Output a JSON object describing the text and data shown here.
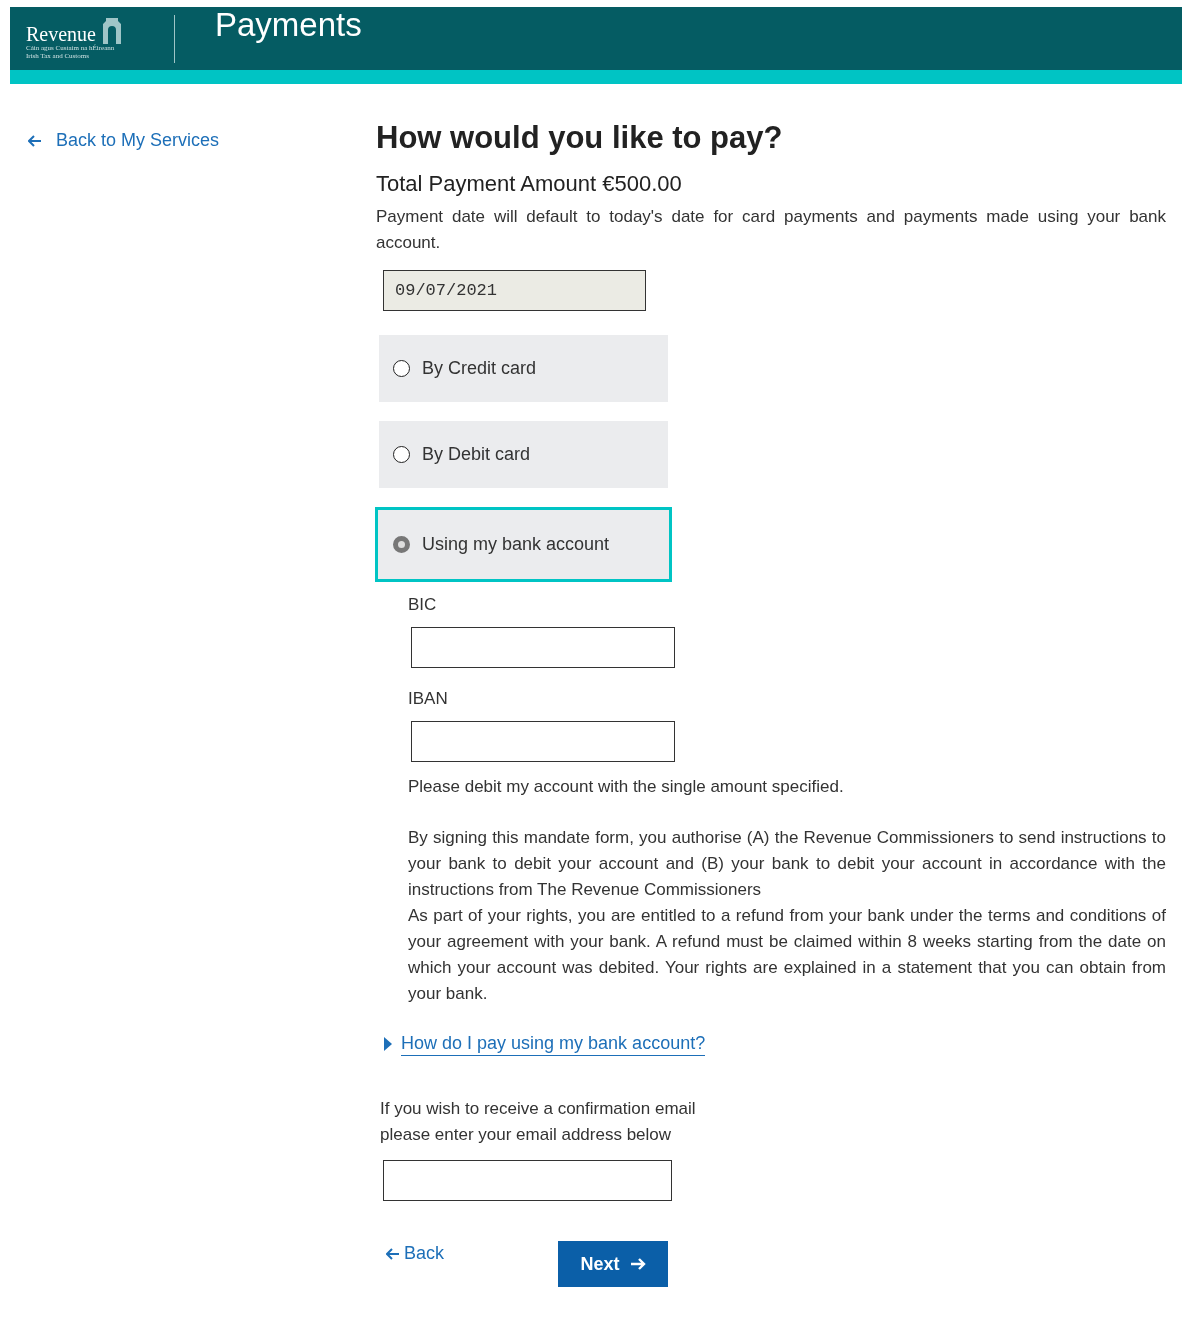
{
  "header": {
    "logo": {
      "name": "Revenue",
      "line_1": "Cáin agus Custaim na hÉireann",
      "line_2": "Irish Tax and Customs"
    },
    "title": "Payments"
  },
  "back_link": "Back to My Services",
  "heading": "How would you like to pay?",
  "total": "Total Payment Amount €500.00",
  "date_note": "Payment date will default to today's date for card payments and payments made using your bank account.",
  "date_field": {
    "value": "09/07/2021",
    "disabled": true
  },
  "payment_options": [
    {
      "label": "By Credit card",
      "selected": false
    },
    {
      "label": "By Debit card",
      "selected": false
    },
    {
      "label": "Using my bank account",
      "selected": true
    }
  ],
  "bank_fields": [
    {
      "label": "BIC"
    },
    {
      "label": "IBAN"
    }
  ],
  "debit_note": "Please debit my account with the single amount specified.",
  "mandate_paragraphs": [
    "By signing this mandate form, you authorise (A) the Revenue Commissioners to send instructions to your bank to debit your account and (B) your bank to debit your account in accordance with the instructions from The Revenue Commissioners",
    "As part of your rights, you are entitled to a refund from your bank under the terms and conditions of your agreement with your bank. A refund must be claimed within 8 weeks starting from the date on which your account was debited. Your rights are explained in a statement that you can obtain from your bank."
  ],
  "help_toggle": {
    "label": "How do I pay using my bank account?",
    "expanded": false
  },
  "email_prompt": "If you wish to receive a confirmation email please enter your email address below",
  "buttons": {
    "back": "Back",
    "next": "Next"
  }
}
